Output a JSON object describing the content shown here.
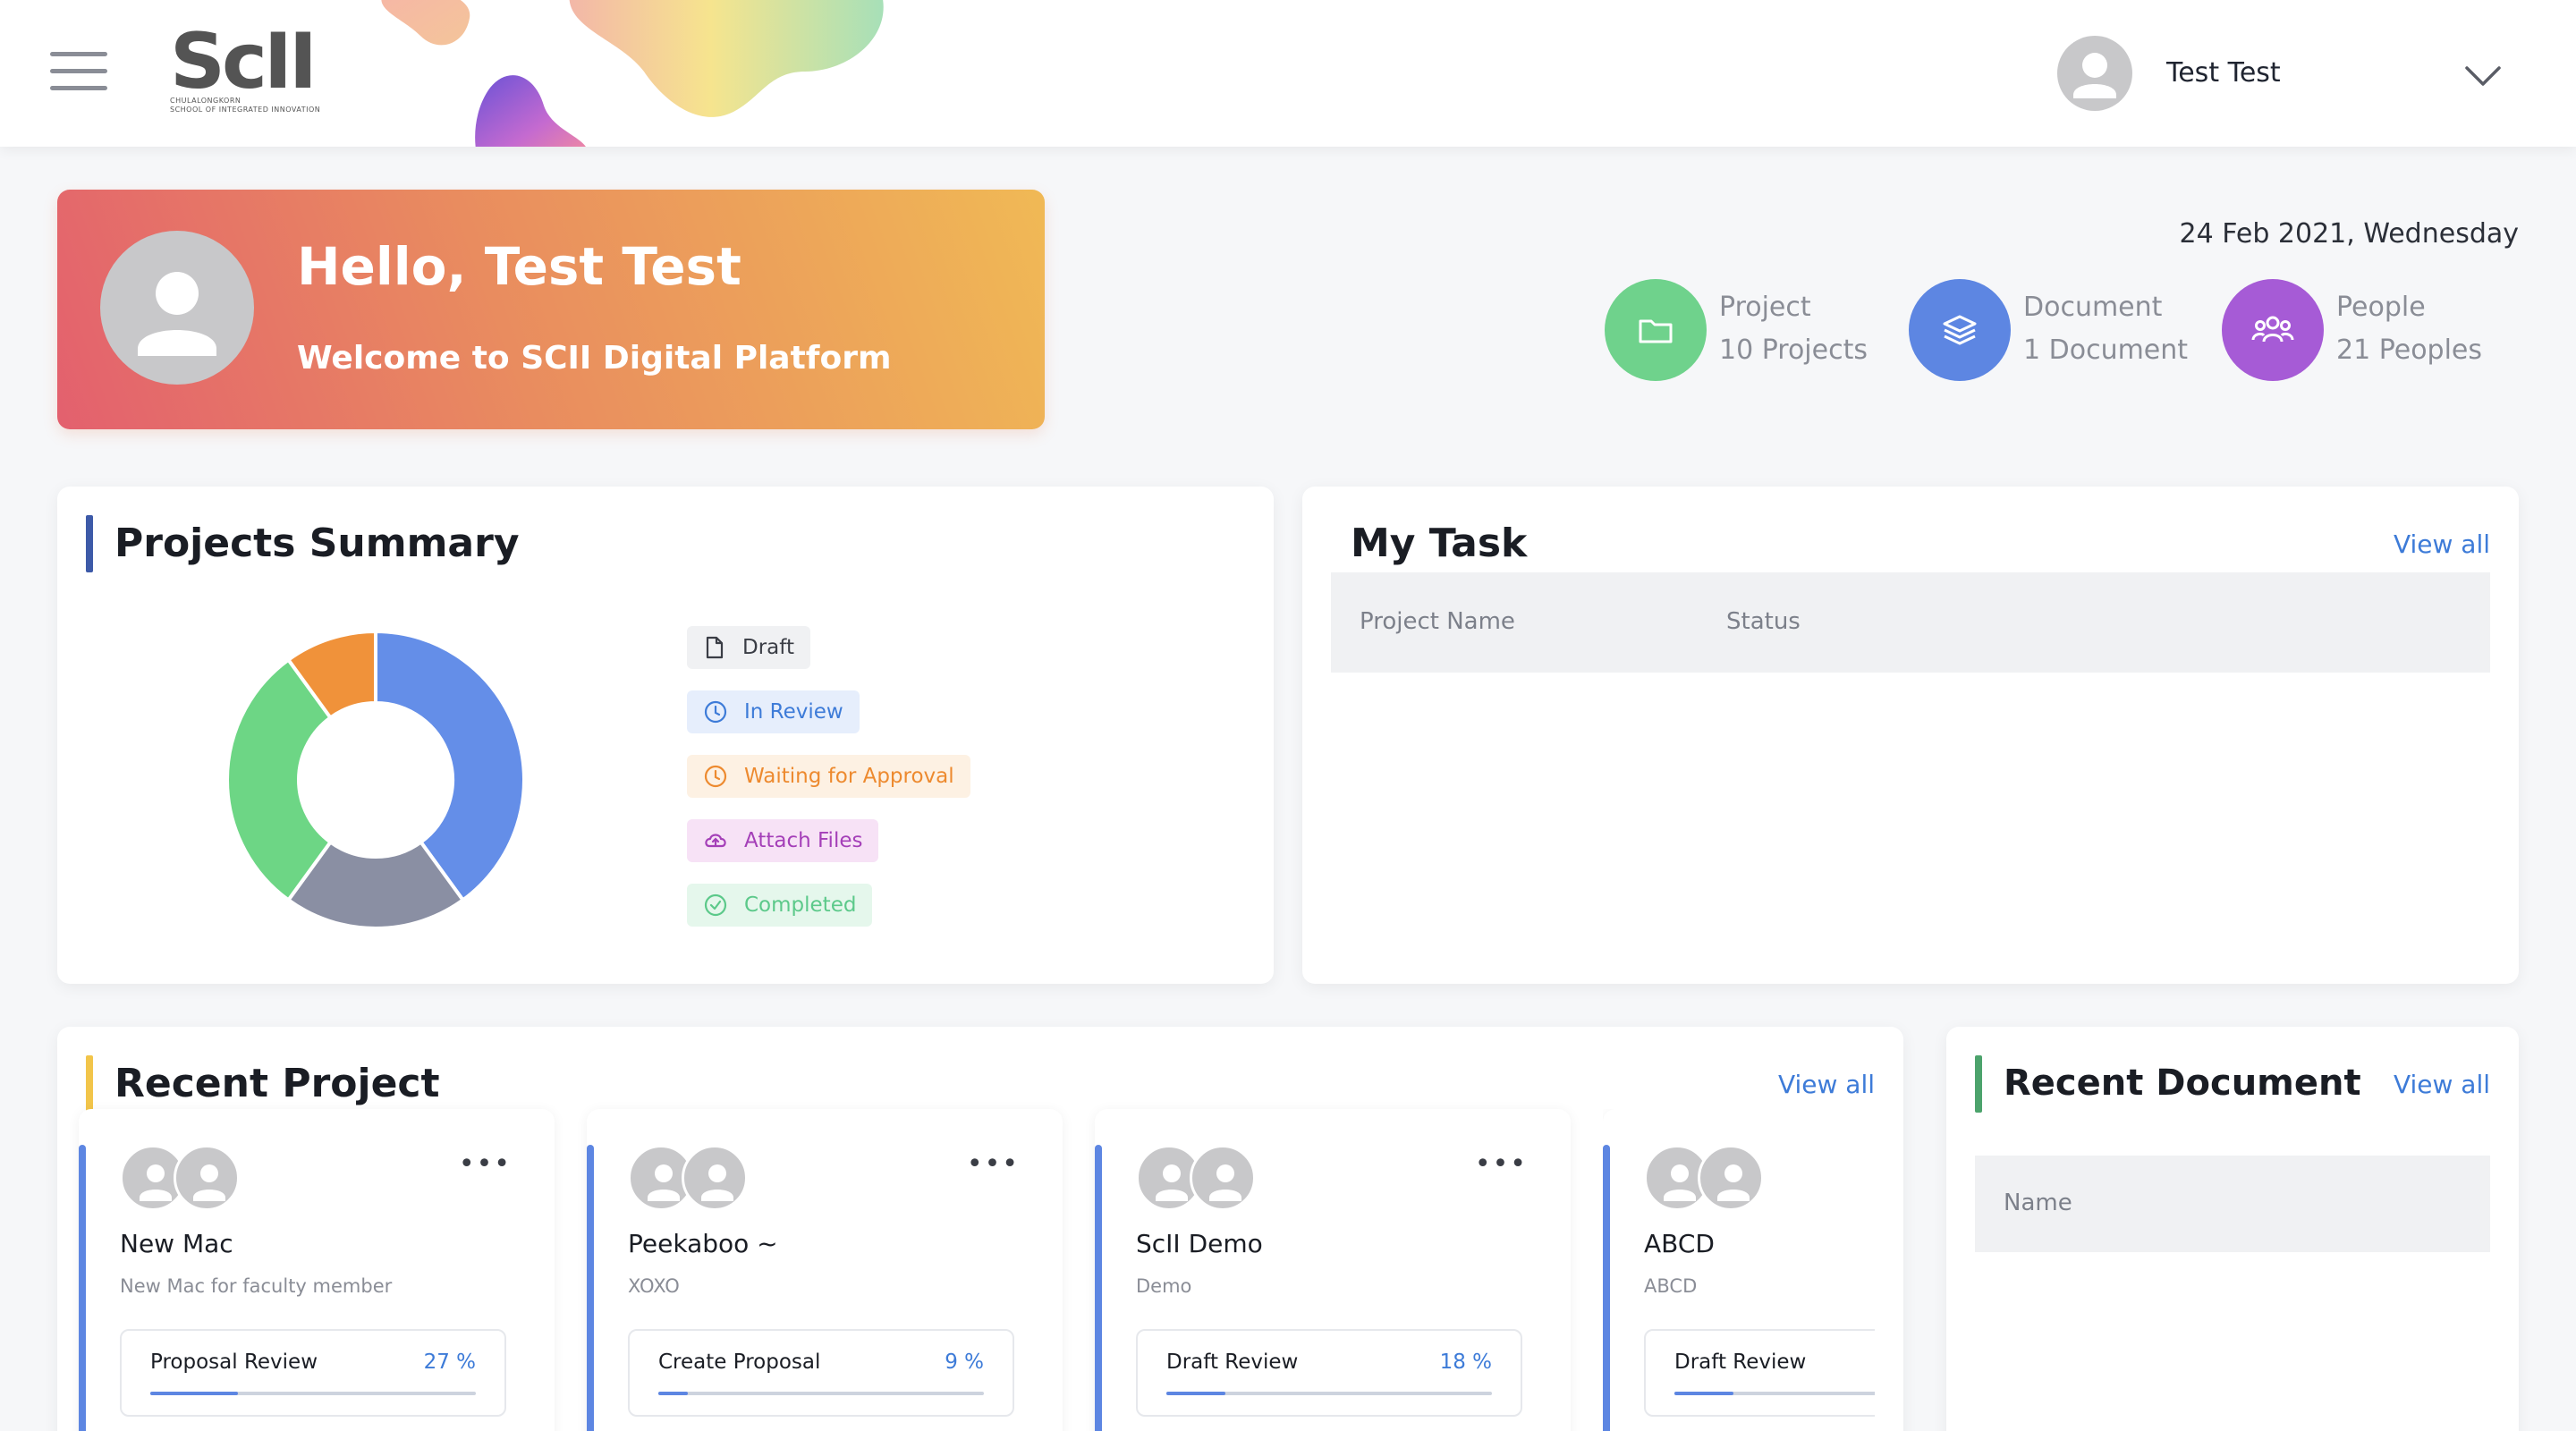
{
  "header": {
    "logo_text": "ScII",
    "logo_subtitle_1": "CHULALONGKORN",
    "logo_subtitle_2": "SCHOOL OF INTEGRATED INNOVATION",
    "user_name": "Test Test"
  },
  "welcome": {
    "title": "Hello, Test Test",
    "subtitle": "Welcome to SCII Digital Platform"
  },
  "date": "24 Feb 2021, Wednesday",
  "stats": [
    {
      "label": "Project",
      "value": "10 Projects",
      "color": "#6fd28c",
      "icon": "folder-icon"
    },
    {
      "label": "Document",
      "value": "1 Document",
      "color": "#5d86e2",
      "icon": "layers-icon"
    },
    {
      "label": "People",
      "value": "21 Peoples",
      "color": "#a65bd6",
      "icon": "people-icon"
    }
  ],
  "projects_summary": {
    "title": "Projects Summary",
    "legend": [
      {
        "label": "Draft",
        "icon": "file-icon",
        "text_color": "#3a3d45",
        "bg": "#f0f1f3"
      },
      {
        "label": "In Review",
        "icon": "clock-icon",
        "text_color": "#3d7bd8",
        "bg": "#e6eefc"
      },
      {
        "label": "Waiting for Approval",
        "icon": "clock-icon",
        "text_color": "#ed8a2f",
        "bg": "#fdf1e3"
      },
      {
        "label": "Attach Files",
        "icon": "cloud-upload-icon",
        "text_color": "#a43fb8",
        "bg": "#f7e2f6"
      },
      {
        "label": "Completed",
        "icon": "check-circle-icon",
        "text_color": "#5cc98a",
        "bg": "#e5f7ec"
      }
    ]
  },
  "chart_data": {
    "type": "pie",
    "title": "",
    "categories": [
      "In Review",
      "Draft",
      "Completed",
      "Waiting for Approval"
    ],
    "values": [
      40,
      20,
      30,
      10
    ],
    "colors": [
      "#648ee8",
      "#8a8fa3",
      "#6dd685",
      "#f0923a"
    ],
    "donut": true
  },
  "my_task": {
    "title": "My Task",
    "view_all": "View all",
    "columns": [
      "Project Name",
      "Status"
    ]
  },
  "recent_project": {
    "title": "Recent Project",
    "view_all": "View all",
    "items": [
      {
        "name": "New Mac",
        "desc": "New Mac for faculty member",
        "status": "Proposal Review",
        "percent": "27 %",
        "progress": 0.27
      },
      {
        "name": "Peekaboo ~",
        "desc": "XOXO",
        "status": "Create Proposal",
        "percent": "9 %",
        "progress": 0.09
      },
      {
        "name": "ScII Demo",
        "desc": "Demo",
        "status": "Draft Review",
        "percent": "18 %",
        "progress": 0.18
      },
      {
        "name": "ABCD",
        "desc": "ABCD",
        "status": "Draft Review",
        "percent": "",
        "progress": 0.18
      }
    ]
  },
  "recent_document": {
    "title": "Recent Document",
    "view_all": "View all",
    "columns": [
      "Name"
    ]
  }
}
